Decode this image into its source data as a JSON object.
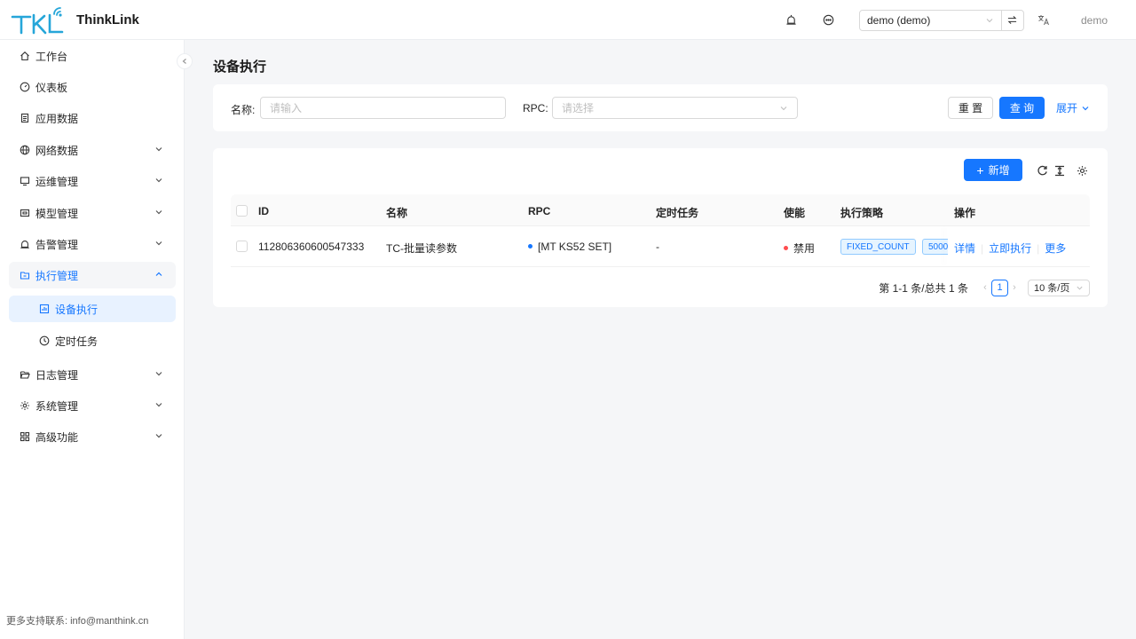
{
  "app": {
    "title": "ThinkLink",
    "logo_text": "TKL"
  },
  "header": {
    "tenant": "demo (demo)",
    "user": "demo",
    "icons": [
      "alarm-icon",
      "message-icon",
      "swap-icon",
      "translate-icon"
    ]
  },
  "sidebar": {
    "items": [
      {
        "label": "工作台",
        "icon": "home-icon"
      },
      {
        "label": "仪表板",
        "icon": "dashboard-icon"
      },
      {
        "label": "应用数据",
        "icon": "document-icon"
      },
      {
        "label": "网络数据",
        "icon": "globe-icon"
      },
      {
        "label": "运维管理",
        "icon": "monitor-icon"
      },
      {
        "label": "模型管理",
        "icon": "model-icon"
      },
      {
        "label": "告警管理",
        "icon": "alarm-icon"
      },
      {
        "label": "执行管理",
        "icon": "folder-icon"
      },
      {
        "label": "日志管理",
        "icon": "folder-open-icon"
      },
      {
        "label": "系统管理",
        "icon": "gear-icon"
      },
      {
        "label": "高级功能",
        "icon": "grid-icon"
      }
    ],
    "sub_items": [
      {
        "label": "设备执行",
        "icon": "chart-icon"
      },
      {
        "label": "定时任务",
        "icon": "clock-icon"
      }
    ],
    "footer": "更多支持联系: info@manthink.cn"
  },
  "page": {
    "title": "设备执行"
  },
  "search": {
    "name_label": "名称:",
    "name_placeholder": "请输入",
    "rpc_label": "RPC:",
    "rpc_placeholder": "请选择",
    "reset": "重 置",
    "query": "查 询",
    "expand": "展开"
  },
  "toolbar": {
    "add": "新增"
  },
  "table": {
    "columns": [
      "ID",
      "名称",
      "RPC",
      "定时任务",
      "使能",
      "执行策略",
      "操作"
    ],
    "rows": [
      {
        "id": "112806360600547333",
        "name": "TC-批量读参数",
        "rpc": "[MT KS52 SET]",
        "schedule": "-",
        "enabled": "禁用",
        "strategy": "FIXED_COUNT",
        "strategy_value": "5000",
        "actions": [
          "详情",
          "立即执行",
          "更多"
        ]
      }
    ]
  },
  "pagination": {
    "summary": "第 1-1 条/总共 1 条",
    "current": "1",
    "page_size": "10 条/页"
  },
  "colors": {
    "primary": "#1677ff",
    "disabled_dot": "#ff4d4f"
  }
}
